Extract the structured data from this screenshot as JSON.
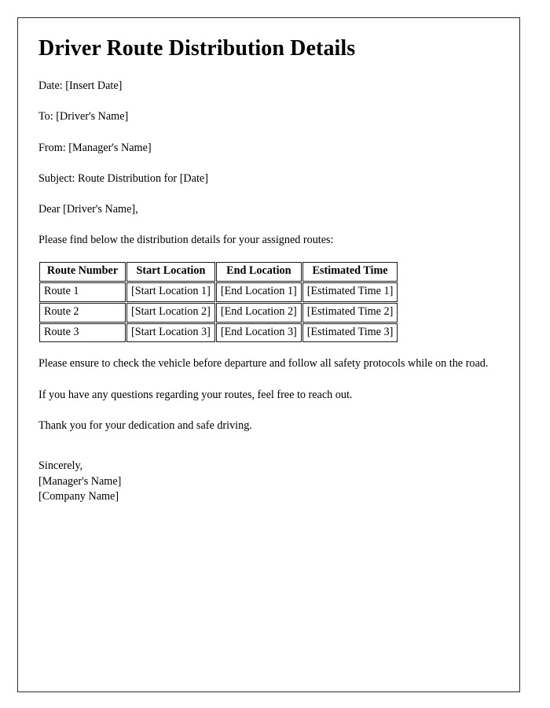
{
  "document": {
    "title": "Driver Route Distribution Details",
    "header_fields": [
      {
        "label": "Date",
        "text": "Date: [Insert Date]"
      },
      {
        "label": "To",
        "text": "To: [Driver's Name]"
      },
      {
        "label": "From",
        "text": "From: [Manager's Name]"
      },
      {
        "label": "Subject",
        "text": "Subject: Route Distribution for [Date]"
      }
    ],
    "salutation": "Dear [Driver's Name],",
    "intro_paragraph": "Please find below the distribution details for your assigned routes:",
    "table": {
      "columns": [
        "Route Number",
        "Start Location",
        "End Location",
        "Estimated Time"
      ],
      "rows": [
        [
          "Route 1",
          "[Start Location 1]",
          "[End Location 1]",
          "[Estimated Time 1]"
        ],
        [
          "Route 2",
          "[Start Location 2]",
          "[End Location 2]",
          "[Estimated Time 2]"
        ],
        [
          "Route 3",
          "[Start Location 3]",
          "[End Location 3]",
          "[Estimated Time 3]"
        ]
      ]
    },
    "body_paragraphs": [
      "Please ensure to check the vehicle before departure and follow all safety protocols while on the road.",
      "If you have any questions regarding your routes, feel free to reach out.",
      "Thank you for your dedication and safe driving."
    ],
    "signature": {
      "closing": "Sincerely,",
      "sender_name": "[Manager's Name]",
      "company_name": "[Company Name]"
    }
  },
  "colors": {
    "page_background": "#ffffff",
    "text": "#000000",
    "page_border": "#2b2b2b",
    "table_border": "#1c1c1c"
  }
}
